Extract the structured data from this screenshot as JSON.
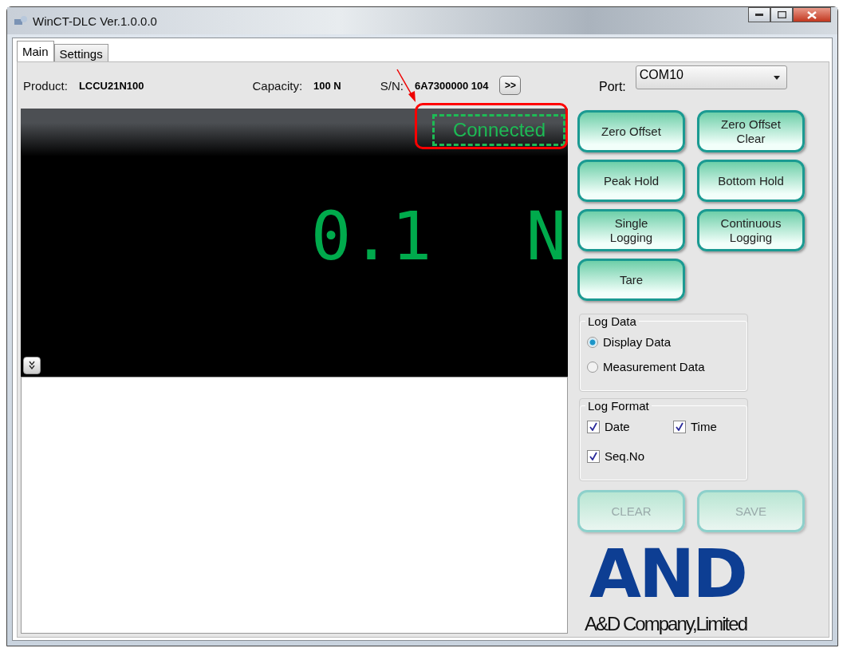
{
  "window": {
    "title": "WinCT-DLC Ver.1.0.0.0"
  },
  "tabs": [
    {
      "label": "Main",
      "selected": true
    },
    {
      "label": "Settings",
      "selected": false
    }
  ],
  "info": {
    "product_label": "Product:",
    "product": "LCCU21N100",
    "capacity_label": "Capacity:",
    "capacity": "100  N",
    "sn_label": "S/N:",
    "sn": "6A7300000 104",
    "more_button": ">>"
  },
  "port": {
    "label": "Port:",
    "value": "COM10"
  },
  "display": {
    "status": "Connected",
    "connected": true,
    "value": "0.1",
    "unit": "N"
  },
  "buttons": [
    {
      "label": "Zero Offset",
      "disabled": false
    },
    {
      "label": "Zero Offset Clear",
      "disabled": false
    },
    {
      "label": "Peak Hold",
      "disabled": false
    },
    {
      "label": "Bottom Hold",
      "disabled": false
    },
    {
      "label": "Single Logging",
      "disabled": false
    },
    {
      "label": "Continuous Logging",
      "disabled": false
    },
    {
      "label": "Tare",
      "disabled": false
    }
  ],
  "log_data": {
    "title": "Log Data",
    "options": [
      {
        "label": "Display Data",
        "selected": true
      },
      {
        "label": "Measurement Data",
        "selected": false
      }
    ]
  },
  "log_format": {
    "title": "Log Format",
    "options": [
      {
        "label": "Date",
        "checked": true
      },
      {
        "label": "Time",
        "checked": true
      },
      {
        "label": "Seq.No",
        "checked": true
      }
    ]
  },
  "actions": [
    {
      "label": "CLEAR",
      "disabled": true
    },
    {
      "label": "SAVE",
      "disabled": true
    }
  ],
  "logo": {
    "mark": "AND",
    "company": "A&D Company,Limited"
  }
}
